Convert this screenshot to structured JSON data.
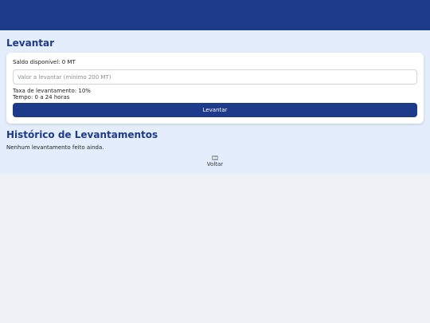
{
  "withdraw": {
    "title": "Levantar",
    "balance_text": "Saldo disponível: 0 MT",
    "amount_placeholder": "Valor a levantar (mínimo 200 MT)",
    "amount_value": "",
    "fee_text": "Taxa de levantamento: 10%",
    "time_text": "Tempo: 0 a 24 horas",
    "submit_label": "Levantar"
  },
  "history": {
    "title": "Histórico de Levantamentos",
    "empty_text": "Nenhum levantamento feito ainda."
  },
  "nav": {
    "back_label": "Voltar",
    "back_icon": "back-icon"
  },
  "colors": {
    "primary": "#1e3a8a",
    "content_bg": "#e3edfc",
    "page_bg": "#eef2f7"
  }
}
